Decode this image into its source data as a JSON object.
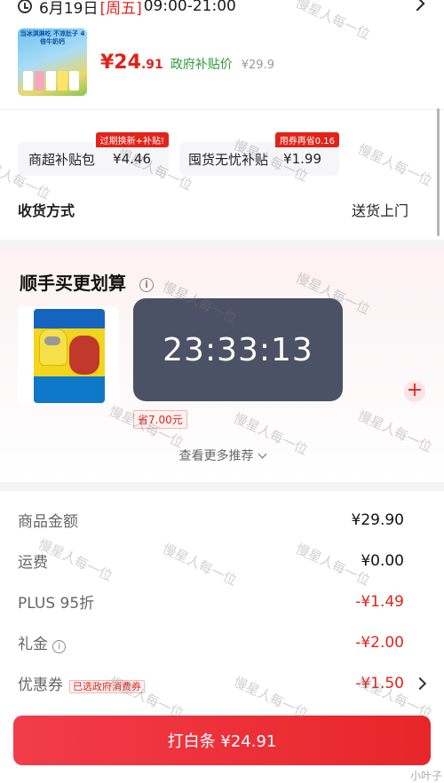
{
  "header": {
    "date": "6月19日",
    "weekday": "[周五]",
    "time_range": "09:00-21:00"
  },
  "product": {
    "thumb_caption": "当冰淇淋吃 不凉肚子 4倍牛奶钙",
    "price_int": "¥24",
    "price_dec": ".91",
    "gov_label": "政府补贴价",
    "orig_price": "¥29.9"
  },
  "subsidies": [
    {
      "badge": "过期换新+补贴!",
      "name": "商超补贴包",
      "value": "¥4.46"
    },
    {
      "badge": "用券再省0.16",
      "name": "囤货无忧补贴",
      "value": "¥1.99"
    }
  ],
  "receive": {
    "label": "收货方式",
    "value": "送货上门"
  },
  "recommend": {
    "title": "顺手买更划算",
    "info": "i",
    "save": "省7.00元",
    "add": "+",
    "more": "查看更多推荐"
  },
  "timer": {
    "text": "23:33:13"
  },
  "fees": [
    {
      "label": "商品金额",
      "value": "¥29.90",
      "red": false
    },
    {
      "label": "运费",
      "value": "¥0.00",
      "red": false
    },
    {
      "label": "PLUS 95折",
      "value": "-¥1.49",
      "red": true
    },
    {
      "label": "礼金",
      "value": "-¥2.00",
      "red": true
    },
    {
      "label": "优惠券",
      "value": "-¥1.50",
      "red": true,
      "tag": "已选政府消费券"
    }
  ],
  "pay": {
    "label": "打白条 ¥24.91"
  },
  "watermark": "慢星人每一位",
  "corner": "小叶子"
}
